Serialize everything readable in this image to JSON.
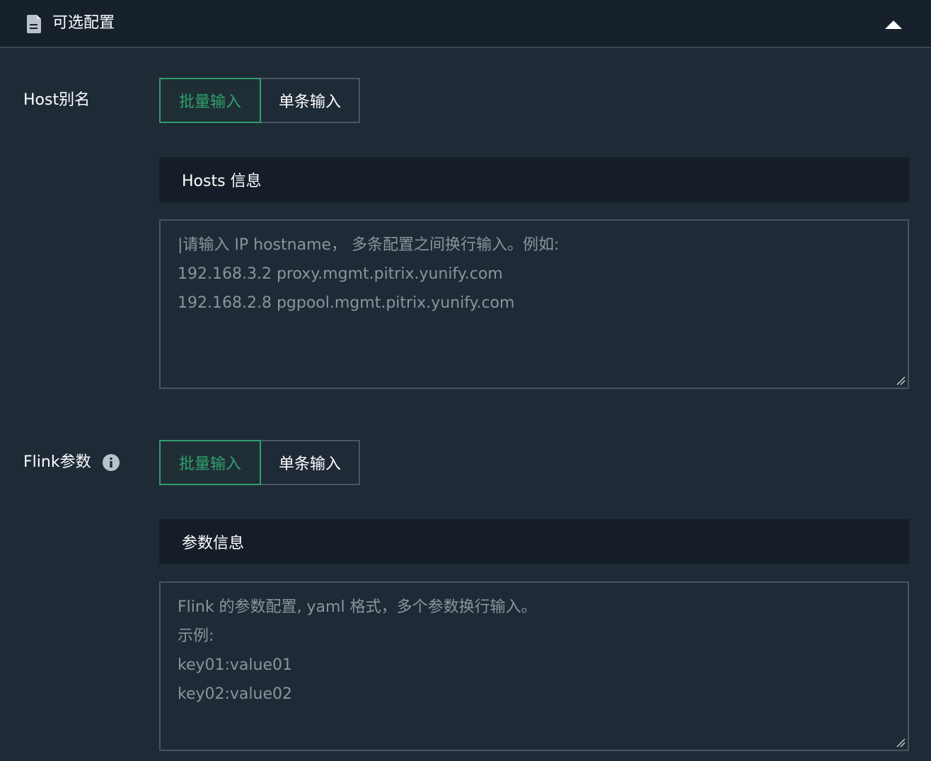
{
  "section": {
    "title": "可选配置",
    "doc_icon": "document-icon",
    "collapse_icon": "caret-up-icon"
  },
  "host_alias": {
    "label": "Host别名",
    "toggle": {
      "batch": "批量输入",
      "single": "单条输入",
      "selected": "批量输入"
    },
    "subheader": "Hosts 信息",
    "placeholder_lines": [
      "|请输入 IP hostname， 多条配置之间换行输入。例如:",
      "192.168.3.2 proxy.mgmt.pitrix.yunify.com",
      "192.168.2.8 pgpool.mgmt.pitrix.yunify.com"
    ]
  },
  "flink_params": {
    "label": "Flink参数",
    "info_icon": "info-icon",
    "toggle": {
      "batch": "批量输入",
      "single": "单条输入",
      "selected": "批量输入"
    },
    "subheader": "参数信息",
    "placeholder_lines": [
      "Flink 的参数配置, yaml 格式，多个参数换行输入。",
      "示例:",
      "key01:value01",
      "key02:value02"
    ]
  },
  "colors": {
    "background": "#1f2a37",
    "header_bg": "#17212c",
    "accent_green": "#2fa26e",
    "subheader_bg": "#151e28",
    "placeholder_text": "#8b939d"
  }
}
